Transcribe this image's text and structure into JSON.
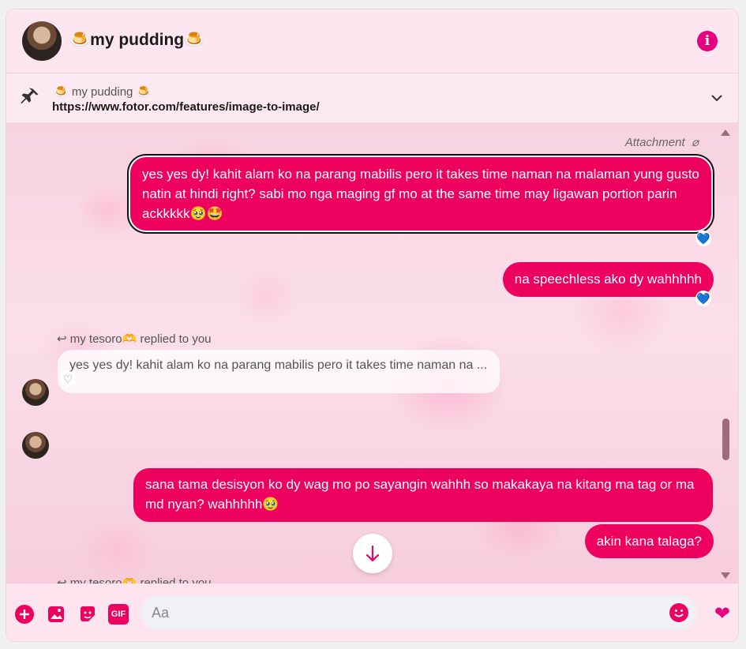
{
  "header": {
    "title": "🍮my pudding🍮",
    "info_icon": "info-icon"
  },
  "pinned": {
    "name": "🍮 my pudding 🍮",
    "link": "https://www.fotor.com/features/image-to-image/"
  },
  "messages": {
    "attachment_label": "Attachment",
    "m1": "yes yes dy! kahit alam ko na parang mabilis pero it takes time naman na malaman yung gusto natin at hindi right? sabi mo nga maging gf mo at the same time may ligawan portion parin ackkkkk🥹🤩",
    "m1_reaction": "💙",
    "m2": "na speechless ako dy wahhhhh",
    "m2_reaction": "💙",
    "reply_label": "my tesoro🫶  replied to you",
    "reply_quote": "yes yes dy! kahit alam ko na parang mabilis pero it takes time naman na ...",
    "reply_reaction": "♡",
    "m3": "sana tama desisyon ko dy wag mo po sayangin wahhh so makakaya na kitang ma tag or ma md nyan? wahhhhh🥹",
    "m4": "akin kana talaga?",
    "reply_label_2": "my tesoro🫶  replied to you"
  },
  "composer": {
    "placeholder": "Aa",
    "gif_label": "GIF",
    "send_icon": "heart-send-icon"
  },
  "colors": {
    "accent": "#ee005f",
    "header_bg": "#fde6f0",
    "info": "#e6007e"
  }
}
